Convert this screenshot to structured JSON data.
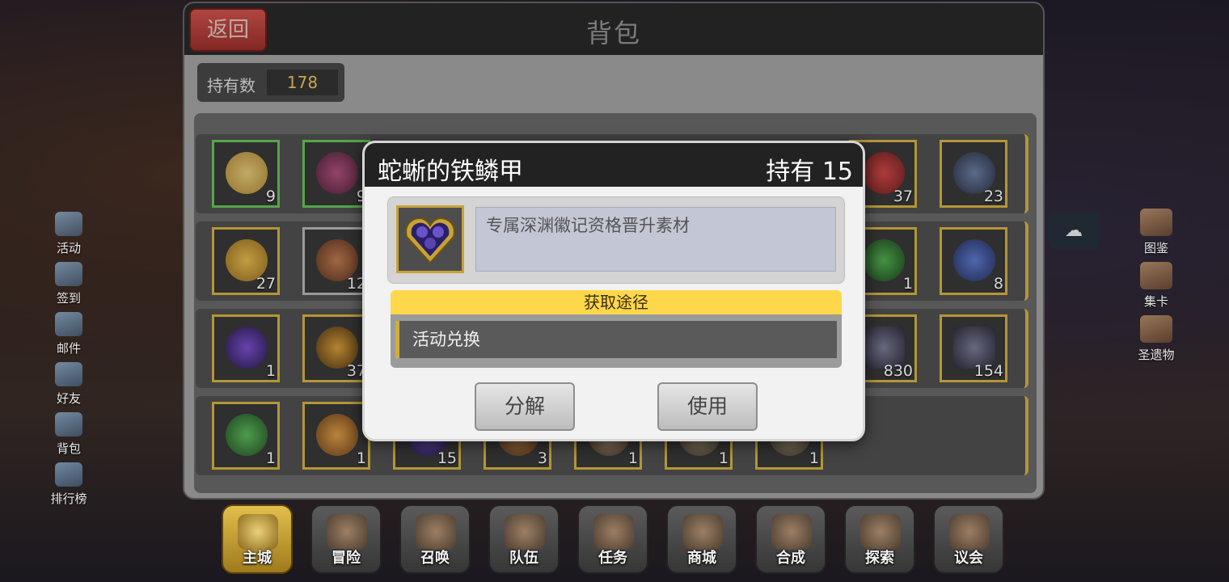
{
  "panel": {
    "title": "背包",
    "back_label": "返回",
    "count_label": "持有数",
    "count_value": "178"
  },
  "left_menu": [
    {
      "label": "活动",
      "icon": "flag-icon"
    },
    {
      "label": "签到",
      "icon": "checkin-icon"
    },
    {
      "label": "邮件",
      "icon": "mail-icon"
    },
    {
      "label": "好友",
      "icon": "friend-icon"
    },
    {
      "label": "背包",
      "icon": "bag-icon"
    },
    {
      "label": "排行榜",
      "icon": "ranking-icon"
    }
  ],
  "right_menu": [
    {
      "label": "图鉴",
      "icon": "book-icon"
    },
    {
      "label": "集卡",
      "icon": "card-icon"
    },
    {
      "label": "圣遗物",
      "icon": "relic-icon"
    }
  ],
  "grid": {
    "row1": [
      "9",
      "9",
      "37",
      "23"
    ],
    "row2": [
      "27",
      "12",
      "1",
      "8"
    ],
    "row3": [
      "1",
      "37",
      "830",
      "154"
    ],
    "row4": [
      "1",
      "1",
      "15",
      "3",
      "1",
      "1",
      "1"
    ]
  },
  "dialog": {
    "item_name": "蛇蜥的铁鳞甲",
    "owned": "持有 15",
    "description": "专属深渊徽记资格晋升素材",
    "source_header": "获取途径",
    "source_item": "活动兑换",
    "decompose_label": "分解",
    "use_label": "使用"
  },
  "bottom_nav": [
    "主城",
    "冒险",
    "召唤",
    "队伍",
    "任务",
    "商城",
    "合成",
    "探索",
    "议会"
  ],
  "colors": {
    "accent_gold": "#b49637",
    "source_yellow": "#fed84a",
    "back_red": "#c8413a"
  }
}
